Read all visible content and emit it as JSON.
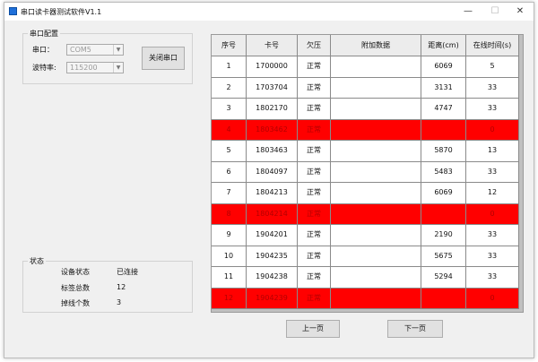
{
  "window": {
    "title": "串口读卡器测试软件V1.1",
    "minimize": "—",
    "maximize": "☐",
    "close": "✕"
  },
  "serial": {
    "group_title": "串口配置",
    "port_label": "串口：",
    "port_value": "COM5",
    "baud_label": "波特率:",
    "baud_value": "115200",
    "close_button": "关闭串口"
  },
  "status": {
    "group_title": "状态",
    "rows": [
      {
        "label": "设备状态",
        "value": "已连接"
      },
      {
        "label": "标签总数",
        "value": "12"
      },
      {
        "label": "掉线个数",
        "value": "3"
      }
    ]
  },
  "table": {
    "headers": [
      "序号",
      "卡号",
      "欠压",
      "附加数据",
      "距离(cm)",
      "在线时间(s)"
    ],
    "rows": [
      {
        "cells": [
          "1",
          "1700000",
          "正常",
          "",
          "6069",
          "5"
        ],
        "offline": false
      },
      {
        "cells": [
          "2",
          "1703704",
          "正常",
          "",
          "3131",
          "33"
        ],
        "offline": false
      },
      {
        "cells": [
          "3",
          "1802170",
          "正常",
          "",
          "4747",
          "33"
        ],
        "offline": false
      },
      {
        "cells": [
          "4",
          "1803462",
          "正常",
          "",
          "",
          "0"
        ],
        "offline": true
      },
      {
        "cells": [
          "5",
          "1803463",
          "正常",
          "",
          "5870",
          "13"
        ],
        "offline": false
      },
      {
        "cells": [
          "6",
          "1804097",
          "正常",
          "",
          "5483",
          "33"
        ],
        "offline": false
      },
      {
        "cells": [
          "7",
          "1804213",
          "正常",
          "",
          "6069",
          "12"
        ],
        "offline": false
      },
      {
        "cells": [
          "8",
          "1804214",
          "正常",
          "",
          "",
          "0"
        ],
        "offline": true
      },
      {
        "cells": [
          "9",
          "1904201",
          "正常",
          "",
          "2190",
          "33"
        ],
        "offline": false
      },
      {
        "cells": [
          "10",
          "1904235",
          "正常",
          "",
          "5675",
          "33"
        ],
        "offline": false
      },
      {
        "cells": [
          "11",
          "1904238",
          "正常",
          "",
          "5294",
          "33"
        ],
        "offline": false
      },
      {
        "cells": [
          "12",
          "1904239",
          "正常",
          "",
          "",
          "0"
        ],
        "offline": true
      }
    ]
  },
  "pager": {
    "prev": "上一页",
    "next": "下一页"
  },
  "colors": {
    "offline_row_bg": "#ff0000",
    "offline_row_text": "#b40000",
    "header_bg": "#ececec",
    "row_bg": "#ffffff"
  }
}
